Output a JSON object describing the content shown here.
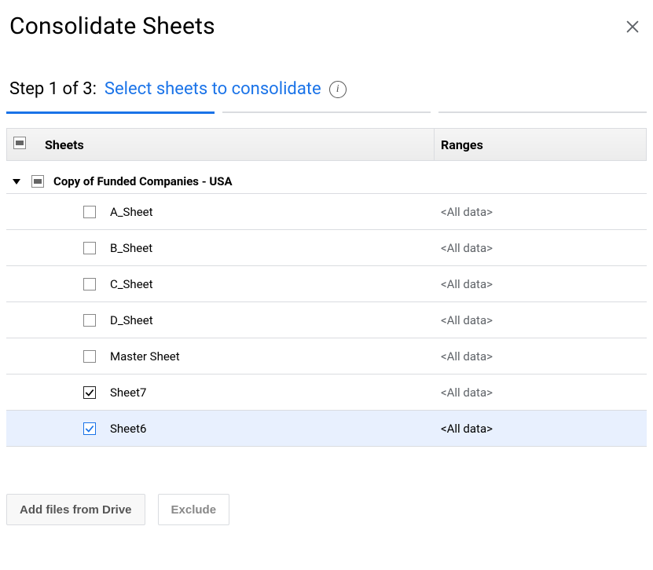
{
  "header": {
    "title": "Consolidate Sheets"
  },
  "step": {
    "prefix": "Step 1 of 3:",
    "action": "Select sheets to consolidate"
  },
  "progress": {
    "active_index": 0,
    "total": 3
  },
  "table": {
    "headers": {
      "sheets": "Sheets",
      "ranges": "Ranges"
    },
    "group": {
      "name": "Copy of Funded Companies - USA",
      "expanded": true,
      "check": "indet"
    },
    "rows": [
      {
        "name": "A_Sheet",
        "range": "<All data>",
        "checked": false,
        "selected": false
      },
      {
        "name": "B_Sheet",
        "range": "<All data>",
        "checked": false,
        "selected": false
      },
      {
        "name": "C_Sheet",
        "range": "<All data>",
        "checked": false,
        "selected": false
      },
      {
        "name": "D_Sheet",
        "range": "<All data>",
        "checked": false,
        "selected": false
      },
      {
        "name": "Master Sheet",
        "range": "<All data>",
        "checked": false,
        "selected": false
      },
      {
        "name": "Sheet7",
        "range": "<All data>",
        "checked": true,
        "selected": false
      },
      {
        "name": "Sheet6",
        "range": "<All data>",
        "checked": true,
        "selected": true
      }
    ]
  },
  "actions": {
    "add": "Add files from Drive",
    "exclude": "Exclude"
  }
}
